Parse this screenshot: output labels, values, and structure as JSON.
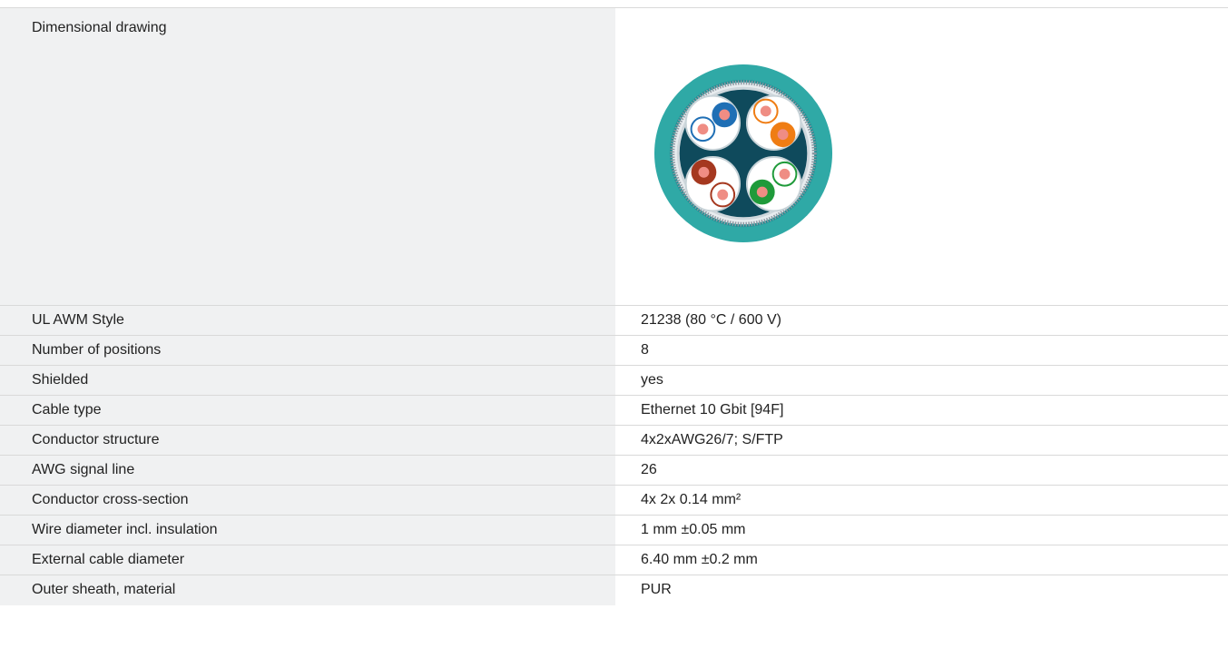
{
  "drawing_row": {
    "label": "Dimensional drawing",
    "image_icon": "cable-cross-section-drawing",
    "colors": {
      "outer_sheath": "#2fa9a6",
      "inner_core": "#0f4a5c",
      "pair_blue": "#1f6fb5",
      "pair_orange": "#ef7d14",
      "pair_brown": "#a5381f",
      "pair_green": "#1f9a3a",
      "copper": "#ef8d84"
    }
  },
  "specs": [
    {
      "label": "UL AWM Style",
      "value": "21238 (80 °C / 600 V)"
    },
    {
      "label": "Number of positions",
      "value": "8"
    },
    {
      "label": "Shielded",
      "value": "yes"
    },
    {
      "label": "Cable type",
      "value": "Ethernet 10 Gbit [94F]"
    },
    {
      "label": "Conductor structure",
      "value": "4x2xAWG26/7; S/FTP"
    },
    {
      "label": "AWG signal line",
      "value": "26"
    },
    {
      "label": "Conductor cross-section",
      "value": "4x 2x 0.14 mm²"
    },
    {
      "label": "Wire diameter incl. insulation",
      "value": "1 mm ±0.05 mm"
    },
    {
      "label": "External cable diameter",
      "value": "6.40 mm ±0.2 mm"
    },
    {
      "label": "Outer sheath, material",
      "value": "PUR"
    }
  ]
}
